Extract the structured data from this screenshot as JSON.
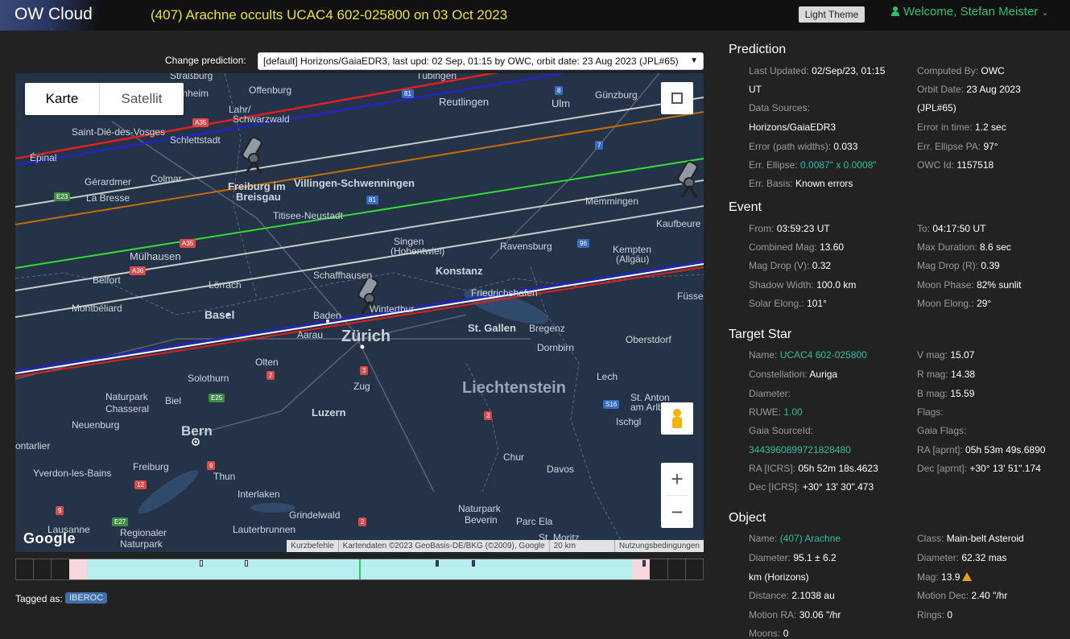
{
  "header": {
    "brand": "OW Cloud",
    "event_title": "(407) Arachne occults UCAC4 602-025800 on 03 Oct 2023",
    "theme_button": "Light Theme",
    "welcome": "Welcome, Stefan Meister"
  },
  "prediction_select": {
    "label": "Change prediction:",
    "value": "[default] Horizons/GaiaEDR3, last upd: 02 Sep, 01:15 by OWC, orbit date: 23 Aug 2023 (JPL#65)"
  },
  "map": {
    "type_karte": "Karte",
    "type_satellit": "Satellit",
    "zoom_in": "+",
    "zoom_out": "−",
    "google": "Google",
    "attribution": [
      "Kurzbefehle",
      "Kartendaten ©2023 GeoBasis-DE/BKG (©2009), Google",
      "20 km",
      "Nutzungsbedingungen"
    ],
    "places": {
      "strasbourg": "Straßburg",
      "offenburg": "Offenburg",
      "tubingen": "Tübingen",
      "reutlingen": "Reutlingen",
      "ulm": "Ulm",
      "gunzburg": "Günzburg",
      "erenheim": "erenheim",
      "lahr": "Lahr/",
      "schwarzwald": "Schwarzwald",
      "saint_die": "Saint-Dié-des-Vosges",
      "schlettstadt": "Schlettstadt",
      "epinal": "Épinal",
      "gerardmer": "Gérardmer",
      "colmar": "Colmar",
      "freiburg": "Freiburg im",
      "breisgau": "Breisgau",
      "villingen": "Villingen-Schwenningen",
      "la_bresse": "La Bresse",
      "memmingen": "Memmingen",
      "kaufbeuren": "Kaufbeure",
      "titisee": "Titisee-Neustadt",
      "mulhausen": "Mülhausen",
      "singen": "Singen",
      "hohentwiel": "(Hohentwiel)",
      "ravensburg": "Ravensburg",
      "kempten": "Kempten",
      "allgau": "(Allgäu)",
      "konstanz": "Konstanz",
      "belfort": "Belfort",
      "lorrach": "Lörrach",
      "schaffhausen": "Schaffhausen",
      "friedrichshafen": "Friedrichshafen",
      "montbeliard": "Montbéliard",
      "basel": "Basel",
      "baden": "Baden",
      "winterthur": "Winterthur",
      "fussen": "Füsse",
      "aarau": "Aarau",
      "zurich": "Zürich",
      "st_gallen": "St. Gallen",
      "bregenz": "Bregenz",
      "dornbirn": "Dornbirn",
      "oberstdorf": "Oberstdorf",
      "olten": "Olten",
      "solothurn": "Solothurn",
      "zug": "Zug",
      "liechtenstein": "Liechtenstein",
      "lech": "Lech",
      "naturpark1": "Naturpark",
      "chasseral": "Chasseral",
      "biel": "Biel",
      "luzern": "Luzern",
      "st_anton": "St. Anton",
      "am_arlberg": "am Arlberg",
      "ischgl": "Ischgl",
      "neuenburg": "Neuenburg",
      "bern": "Bern",
      "pontarlier": "ontarlier",
      "chur": "Chur",
      "yverdon": "Yverdon-les-Bains",
      "freiburg_ch": "Freiburg",
      "thun": "Thun",
      "davos": "Davos",
      "interlaken": "Interlaken",
      "grindelwald": "Grindelwald",
      "naturpark2": "Naturpark",
      "beverin": "Beverin",
      "parc_ela": "Parc Ela",
      "lausanne": "Lausanne",
      "regionaler": "Regionaler",
      "naturpark3": "Naturpark",
      "lauterbrunnen": "Lauterbrunnen",
      "st_moritz": "St. Moritz"
    },
    "roads": [
      "A35",
      "8",
      "81",
      "7",
      "E23",
      "81",
      "A35",
      "96",
      "A36",
      "3",
      "2",
      "E25",
      "S16",
      "3",
      "6",
      "12",
      "9",
      "E27",
      "2"
    ]
  },
  "timeline": {
    "tagged_label": "Tagged as:",
    "tag": "IBEROC"
  },
  "prediction": {
    "title": "Prediction",
    "last_updated_label": "Last Updated:",
    "last_updated": "02/Sep/23, 01:15",
    "last_updated_ut": "UT",
    "computed_by_label": "Computed By:",
    "computed_by": "OWC",
    "data_sources_label": "Data Sources:",
    "data_sources": "Horizons/GaiaEDR3",
    "orbit_date_label": "Orbit Date:",
    "orbit_date": "23 Aug 2023",
    "orbit_jpl": "(JPL#65)",
    "error_time_label": "Error in time:",
    "error_time": "1.2 sec",
    "error_path_label": "Error (path widths):",
    "error_path": "0.033",
    "err_pa_label": "Err. Ellipse PA:",
    "err_pa": "97°",
    "err_ellipse_label": "Err. Ellipse:",
    "err_ellipse": "0.0087\" x 0.0008\"",
    "owc_id_label": "OWC Id:",
    "owc_id": "1157518",
    "err_basis_label": "Err. Basis:",
    "err_basis": "Known errors"
  },
  "event": {
    "title": "Event",
    "from_label": "From:",
    "from": "03:59:23 UT",
    "to_label": "To:",
    "to": "04:17:50 UT",
    "comb_mag_label": "Combined Mag:",
    "comb_mag": "13.60",
    "max_dur_label": "Max Duration:",
    "max_dur": "8.6 sec",
    "mag_drop_v_label": "Mag Drop (V):",
    "mag_drop_v": "0.32",
    "mag_drop_r_label": "Mag Drop (R):",
    "mag_drop_r": "0.39",
    "shadow_label": "Shadow Width:",
    "shadow": "100.0 km",
    "moon_phase_label": "Moon Phase:",
    "moon_phase": "82% sunlit",
    "solar_elong_label": "Solar Elong.:",
    "solar_elong": "101°",
    "moon_elong_label": "Moon Elong.:",
    "moon_elong": "29°"
  },
  "target": {
    "title": "Target Star",
    "name_label": "Name:",
    "name": "UCAC4 602-025800",
    "vmag_label": "V mag:",
    "vmag": "15.07",
    "const_label": "Constellation:",
    "const": "Auriga",
    "rmag_label": "R mag:",
    "rmag": "14.38",
    "diam_label": "Diameter:",
    "bmag_label": "B mag:",
    "bmag": "15.59",
    "ruwe_label": "RUWE:",
    "ruwe": "1.00",
    "flags_label": "Flags:",
    "gaia_src_label": "Gaia SourceId:",
    "gaia_flags_label": "Gaia Flags:",
    "gaia_src": "3443960899721828480",
    "ra_aprnt_label": "RA [aprnt]:",
    "ra_aprnt": "05h 53m 49s.6890",
    "ra_icrs_label": "RA [ICRS]:",
    "ra_icrs": "05h 52m 18s.4623",
    "dec_aprnt_label": "Dec [aprnt]:",
    "dec_aprnt": "+30° 13' 51\".174",
    "dec_icrs_label": "Dec [ICRS]:",
    "dec_icrs": "+30° 13' 30\".473"
  },
  "object": {
    "title": "Object",
    "name_label": "Name:",
    "name": "(407) Arachne",
    "class_label": "Class:",
    "class": "Main-belt Asteroid",
    "diam_label": "Diameter:",
    "diam": "95.1 ± 6.2",
    "diam_mas_label": "Diameter:",
    "diam_mas": "62.32 mas",
    "diam_src": "km (Horizons)",
    "mag_label": "Mag:",
    "mag": "13.9",
    "dist_label": "Distance:",
    "dist": "2.1038 au",
    "motion_dec_label": "Motion Dec:",
    "motion_dec": "2.40 \"/hr",
    "motion_ra_label": "Motion RA:",
    "motion_ra": "30.06 \"/hr",
    "rings_label": "Rings:",
    "rings": "0",
    "moons_label": "Moons:",
    "moons": "0"
  }
}
